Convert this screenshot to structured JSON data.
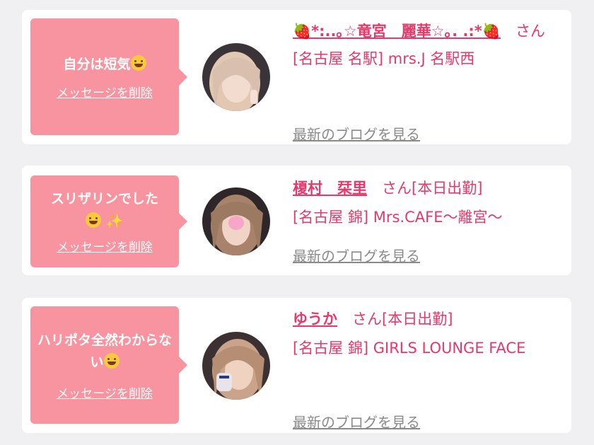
{
  "cards": [
    {
      "message": "自分は短気",
      "emoji": "grinning-sweat-emoji",
      "delete_label": "メッセージを削除",
      "name": "🍓*:..｡☆竜宮　麗華☆｡. .:*🍓",
      "san": "さん",
      "status": "",
      "shop": "[名古屋 名駅] mrs.J 名駅西",
      "blog_label": "最新のブログを見る"
    },
    {
      "message": "スリザリンでした",
      "emoji": "relieved-emoji",
      "sparkle": "✨",
      "delete_label": "メッセージを削除",
      "name": "榎村　栞里",
      "san": "さん",
      "status": "[本日出勤]",
      "shop": "[名古屋 錦] Mrs.CAFE～離宮～",
      "blog_label": "最新のブログを見る"
    },
    {
      "message": "ハリポタ全然わからない",
      "emoji": "smiling-halo-emoji",
      "delete_label": "メッセージを削除",
      "name": "ゆうか",
      "san": "さん",
      "status": "[本日出勤]",
      "shop": "[名古屋 錦] GIRLS LOUNGE FACE",
      "blog_label": "最新のブログを見る"
    }
  ],
  "colors": {
    "bubble": "#f7949f",
    "accent": "#e8386a",
    "link_gray": "#8a8a8a",
    "background": "#f0f0f2"
  }
}
